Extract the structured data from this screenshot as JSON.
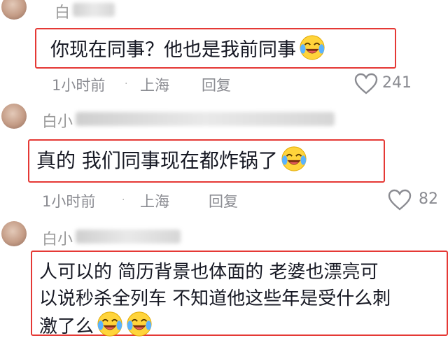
{
  "comments": [
    {
      "username": "白",
      "text": "你现在同事？他也是我前同事",
      "time": "1小时前",
      "location": "上海",
      "reply_label": "回复",
      "likes": "241"
    },
    {
      "username": "白小",
      "text": "真的 我们同事现在都炸锅了",
      "time": "1小时前",
      "location": "上海",
      "reply_label": "回复",
      "likes": "82"
    },
    {
      "username": "白小",
      "text_line1": "人可以的 简历背景也体面的 老婆也漂亮可",
      "text_line2": "以说秒杀全列车 不知道他这些年是受什么刺",
      "text_line3": "激了么"
    }
  ],
  "icons": {
    "emoji": "laughing-crying-emoji-icon",
    "like": "heart-outline-icon"
  },
  "colors": {
    "highlight_border": "#e53935",
    "meta_text": "#8a8b91",
    "body_text": "#161823"
  }
}
